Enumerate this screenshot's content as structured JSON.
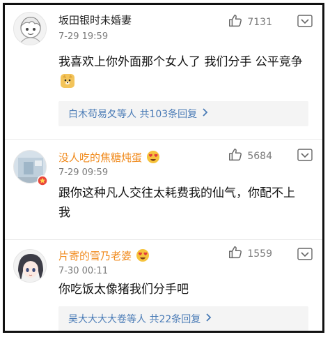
{
  "comments": [
    {
      "name": "坂田银时未婚妻",
      "time": "7-29 19:59",
      "likes": "7131",
      "content": "我喜欢上你外面那个女人了 我们分手 公平竞争",
      "replies": "白木苟易夂等人 共103条回复"
    },
    {
      "name": "没人吃的焦糖炖蛋",
      "time": "7-29 09:59",
      "likes": "5684",
      "content": "跟你这种凡人交往太耗费我的仙气，你配不上我",
      "replies": ""
    },
    {
      "name": "片寄的雪乃老婆",
      "time": "7-30 00:11",
      "likes": "1559",
      "content": "你吃饭太像猪我们分手吧",
      "replies": "吴大大大大卷等人 共22条回复"
    }
  ],
  "icons": {
    "like": "thumbs-up-icon",
    "more": "chevron-down-icon",
    "reply_arrow": "chevron-right-icon",
    "emoji": "heart-eyes-emoji-icon",
    "doge": "doge-emoji-icon"
  },
  "colors": {
    "vip_name": "#f08a1c",
    "reply_link": "#4a7bb6",
    "meta_text": "#7a7a7a"
  }
}
